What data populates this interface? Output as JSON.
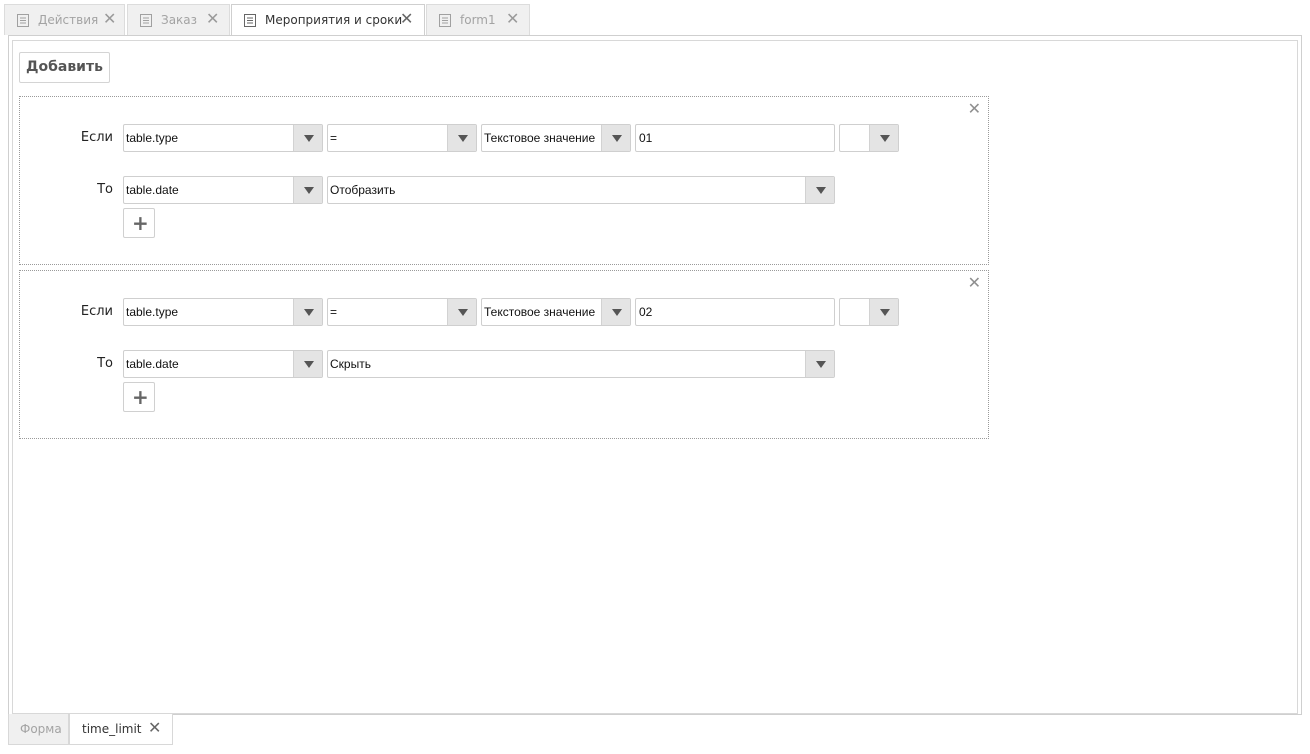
{
  "top_tabs": [
    {
      "label": "Действия",
      "active": false
    },
    {
      "label": "Заказ",
      "active": false
    },
    {
      "label": "Мероприятия и сроки",
      "active": true
    },
    {
      "label": "form1",
      "active": false
    }
  ],
  "toolbar": {
    "add_label": "Добавить"
  },
  "rules": [
    {
      "if_label": "Если",
      "then_label": "То",
      "condition_field": "table.type",
      "operator": "=",
      "value_type": "Текстовое значение",
      "value": "01",
      "extra": "",
      "target_field": "table.date",
      "action": "Отобразить"
    },
    {
      "if_label": "Если",
      "then_label": "То",
      "condition_field": "table.type",
      "operator": "=",
      "value_type": "Текстовое значение",
      "value": "02",
      "extra": "",
      "target_field": "table.date",
      "action": "Скрыть"
    }
  ],
  "bottom_tabs": [
    {
      "label": "Форма",
      "active": false
    },
    {
      "label": "time_limit",
      "active": true
    }
  ],
  "colors": {
    "accent": "#555555",
    "tab_inactive_text": "#a3a3a3",
    "arrow_bg": "#e4e4e4"
  }
}
